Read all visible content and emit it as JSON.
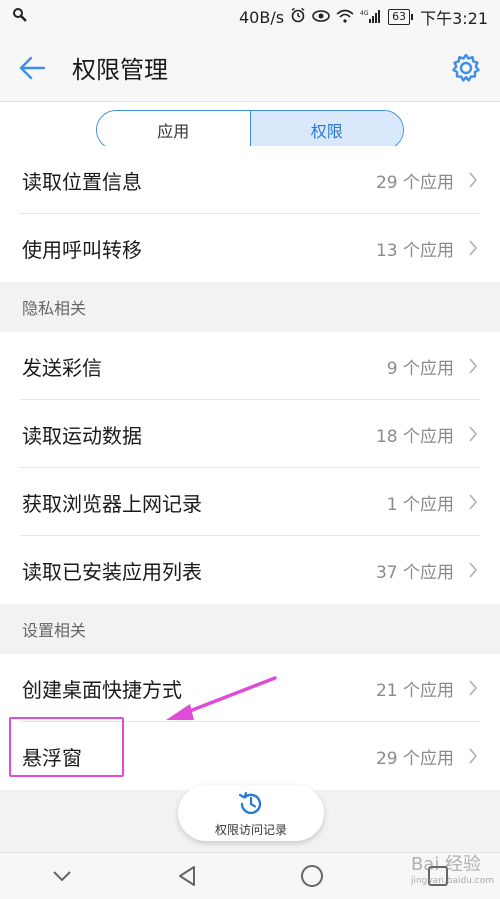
{
  "status_bar": {
    "network_speed": "40B/s",
    "battery": "63",
    "time": "下午3:21",
    "icons": [
      "wrench-icon",
      "alarm-icon",
      "eye-icon",
      "wifi-icon",
      "signal-4g-icon",
      "battery-icon"
    ]
  },
  "app_bar": {
    "title": "权限管理",
    "back_icon": "arrow-left-icon",
    "settings_icon": "gear-icon"
  },
  "tabs": {
    "items": [
      {
        "label": "应用",
        "active": false
      },
      {
        "label": "权限",
        "active": true
      }
    ]
  },
  "groups": {
    "top": [
      {
        "name": "读取位置信息",
        "count": "29 个应用"
      },
      {
        "name": "使用呼叫转移",
        "count": "13 个应用"
      }
    ],
    "privacy": {
      "header": "隐私相关",
      "items": [
        {
          "name": "发送彩信",
          "count": "9 个应用"
        },
        {
          "name": "读取运动数据",
          "count": "18 个应用"
        },
        {
          "name": "获取浏览器上网记录",
          "count": "1 个应用"
        },
        {
          "name": "读取已安装应用列表",
          "count": "37 个应用"
        }
      ]
    },
    "settings": {
      "header": "设置相关",
      "items": [
        {
          "name": "创建桌面快捷方式",
          "count": "21 个应用"
        },
        {
          "name": "悬浮窗",
          "count": "29 个应用"
        }
      ]
    }
  },
  "history_button": {
    "label": "权限访问记录",
    "icon": "history-clock-icon"
  },
  "nav_bar": {
    "icons": [
      "collapse-down-icon",
      "back-triangle-icon",
      "home-circle-icon",
      "recents-square-icon"
    ]
  },
  "watermark": {
    "text": "Bai 经验",
    "sub": "jingyan.baidu.com"
  },
  "colors": {
    "accent": "#3f8ee8",
    "annotation": "#e04cd8",
    "secondary_text": "#8a8a8a"
  }
}
